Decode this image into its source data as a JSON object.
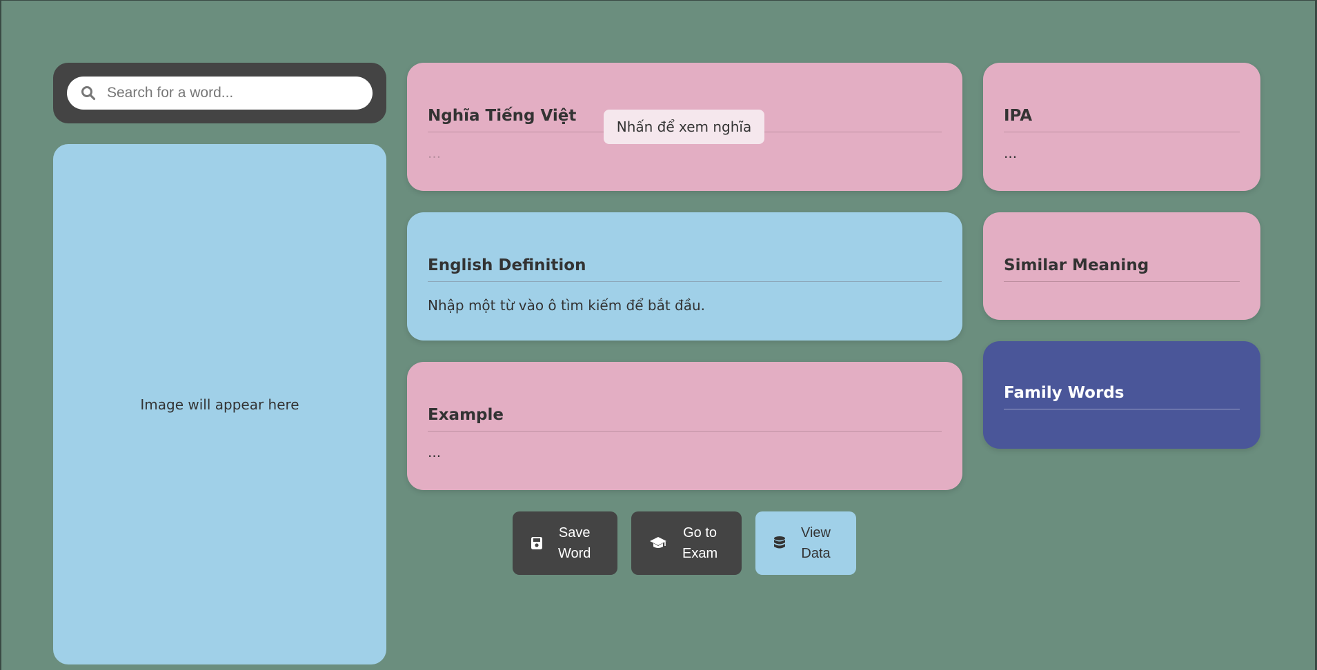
{
  "search": {
    "placeholder": "Search for a word..."
  },
  "image_panel": {
    "placeholder_text": "Image will appear here"
  },
  "cards": {
    "vietnamese": {
      "title": "Nghĩa Tiếng Việt",
      "body": "..."
    },
    "english_definition": {
      "title": "English Definition",
      "body": "Nhập một từ vào ô tìm kiếm để bắt đầu."
    },
    "example": {
      "title": "Example",
      "body": "..."
    },
    "ipa": {
      "title": "IPA",
      "body": "..."
    },
    "similar_meaning": {
      "title": "Similar Meaning",
      "body": ""
    },
    "family_words": {
      "title": "Family Words",
      "body": ""
    }
  },
  "tooltip": {
    "text": "Nhấn để xem nghĩa"
  },
  "buttons": {
    "save": {
      "line1": "Save",
      "line2": "Word",
      "icon": "save-icon"
    },
    "exam": {
      "line1": "Go to",
      "line2": "Exam",
      "icon": "graduation-cap-icon"
    },
    "data": {
      "line1": "View",
      "line2": "Data",
      "icon": "database-icon"
    }
  },
  "colors": {
    "background": "#6b8e7e",
    "dark_panel": "#444444",
    "pink_card": "#e3aec3",
    "blue_card": "#a0d0e8",
    "indigo_card": "#4a5699"
  }
}
